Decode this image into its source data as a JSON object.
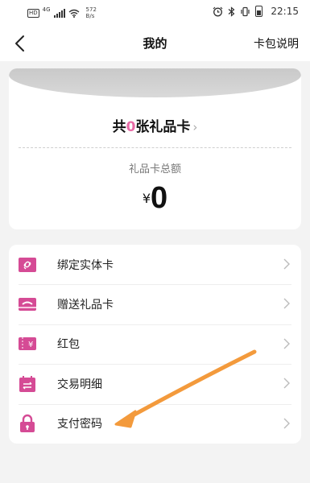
{
  "status_bar": {
    "hd": "HD",
    "network": "4G",
    "speed_value": "572",
    "speed_unit": "B/s",
    "time": "22:15"
  },
  "nav": {
    "title": "我的",
    "right_link": "卡包说明"
  },
  "summary": {
    "count_prefix": "共",
    "count_value": "0",
    "count_suffix": "张礼品卡",
    "total_label": "礼品卡总额",
    "currency": "¥",
    "total_value": "0"
  },
  "menu": [
    {
      "label": "绑定实体卡",
      "icon": "link-card-icon"
    },
    {
      "label": "赠送礼品卡",
      "icon": "gift-card-icon"
    },
    {
      "label": "红包",
      "icon": "red-packet-icon"
    },
    {
      "label": "交易明细",
      "icon": "transaction-calendar-icon"
    },
    {
      "label": "支付密码",
      "icon": "lock-icon"
    }
  ],
  "colors": {
    "accent": "#d54b95",
    "count_highlight": "#e86aa6",
    "annotation_arrow": "#f39a3c"
  }
}
